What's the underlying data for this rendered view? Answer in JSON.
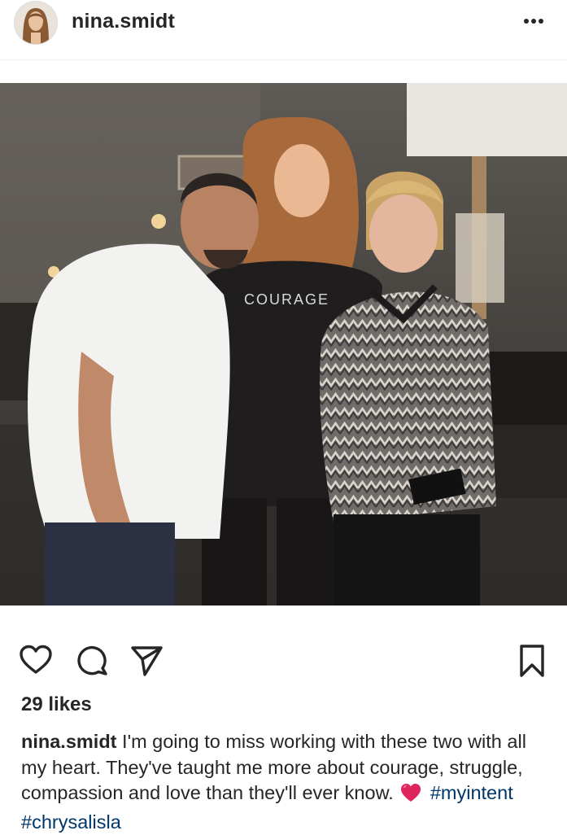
{
  "post": {
    "username": "nina.smidt",
    "likes": "29 likes",
    "caption": {
      "username": "nina.smidt",
      "text": "I'm going to miss working with these two with all my heart. They've taught me more about courage, struggle, compassion and love than they'll ever know.",
      "emoji": "heart-emoji",
      "hashtags": [
        "#myintent",
        "#chrysalisla"
      ]
    },
    "photo_shirt_text": "COURAGE"
  },
  "icons": {
    "more": "more-options-icon",
    "like": "heart-icon",
    "comment": "comment-icon",
    "share": "send-icon",
    "save": "bookmark-icon"
  },
  "colors": {
    "text": "#262626",
    "hashtag": "#00376b",
    "heart_emoji": "#e0245e"
  }
}
